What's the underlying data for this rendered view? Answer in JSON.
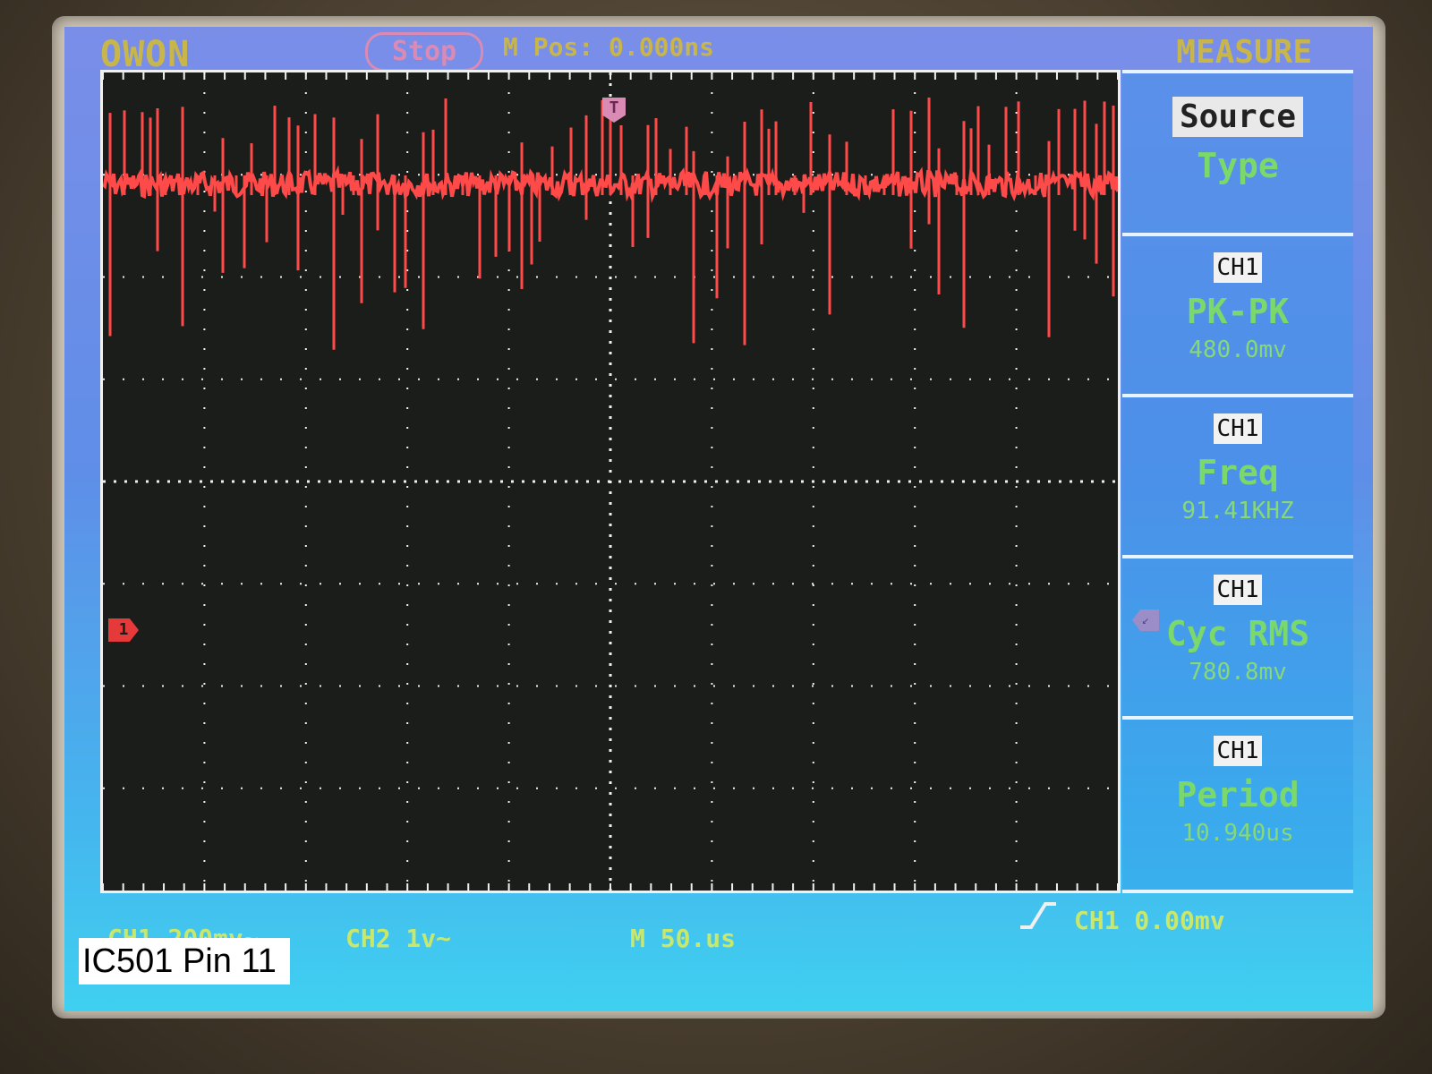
{
  "header": {
    "brand": "OWON",
    "status": "Stop",
    "mpos": "M Pos: 0.000ns",
    "menu_title": "MEASURE"
  },
  "markers": {
    "trigger_position": "T",
    "ch1_ground": "1"
  },
  "side_menu": {
    "source_label": "Source",
    "type_label": "Type",
    "measurements": [
      {
        "channel": "CH1",
        "name": "PK-PK",
        "value": "480.0mv"
      },
      {
        "channel": "CH1",
        "name": "Freq",
        "value": "91.41KHZ"
      },
      {
        "channel": "CH1",
        "name": "Cyc RMS",
        "value": "780.8mv"
      },
      {
        "channel": "CH1",
        "name": "Period",
        "value": "10.940us"
      }
    ]
  },
  "footer": {
    "ch1_scale": "CH1 200mv~",
    "ch2_scale": "CH2 1v~",
    "timebase": "M 50.us",
    "trigger": "CH1 0.00mv"
  },
  "caption": "IC501 Pin 11",
  "colors": {
    "trace": "#ff4a4a",
    "grid": "#f0f0f0",
    "label_green": "#7bd86a",
    "label_yellow": "#c9b64a",
    "status_pink": "#d98ab5"
  },
  "icons": {
    "trigger_edge": "rising-edge-icon"
  }
}
